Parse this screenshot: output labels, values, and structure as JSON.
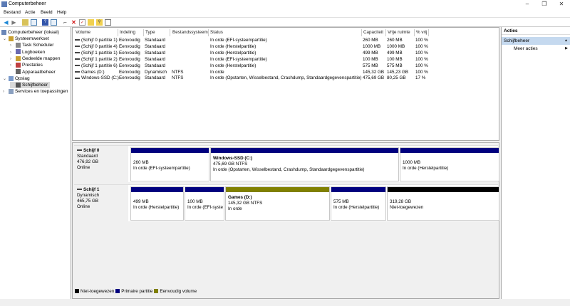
{
  "window": {
    "title": "Computerbeheer",
    "minimize": "–",
    "maximize": "❐",
    "close": "✕"
  },
  "menu": [
    "Bestand",
    "Actie",
    "Beeld",
    "Help"
  ],
  "toolbar_icons": [
    "back-icon",
    "forward-icon",
    "up-folder-icon",
    "show-hide-tree-icon",
    "help-icon",
    "properties-icon",
    "connect-icon",
    "delete-icon",
    "check-icon",
    "new-folder-icon",
    "search-icon",
    "view-icon"
  ],
  "tree": {
    "root": "Computerbeheer (lokaal)",
    "items": [
      {
        "label": "Systeemwerkset",
        "level": 1,
        "expand": "⌄"
      },
      {
        "label": "Task Scheduler",
        "level": 2,
        "expand": "›"
      },
      {
        "label": "Logboeken",
        "level": 2,
        "expand": "›"
      },
      {
        "label": "Gedeelde mappen",
        "level": 2,
        "expand": "›"
      },
      {
        "label": "Prestaties",
        "level": 2,
        "expand": "›"
      },
      {
        "label": "Apparaatbeheer",
        "level": 2,
        "expand": ""
      },
      {
        "label": "Opslag",
        "level": 1,
        "expand": "⌄"
      },
      {
        "label": "Schijfbeheer",
        "level": 2,
        "expand": "",
        "selected": true
      },
      {
        "label": "Services en toepassingen",
        "level": 1,
        "expand": "›"
      }
    ]
  },
  "volumes": {
    "columns": [
      "Volume",
      "Indeling",
      "Type",
      "Bestandssysteem",
      "Status",
      "Capaciteit",
      "Vrije ruimte",
      "% vrij"
    ],
    "rows": [
      [
        "(Schijf 0 partitie 1)",
        "Eenvoudig",
        "Standaard",
        "",
        "In orde (EFI-systeempartitie)",
        "260 MB",
        "260 MB",
        "100 %"
      ],
      [
        "(Schijf 0 partitie 4)",
        "Eenvoudig",
        "Standaard",
        "",
        "In orde (Herstelpartitie)",
        "1000 MB",
        "1000 MB",
        "100 %"
      ],
      [
        "(Schijf 1 partitie 1)",
        "Eenvoudig",
        "Standaard",
        "",
        "In orde (Herstelpartitie)",
        "499 MB",
        "499 MB",
        "100 %"
      ],
      [
        "(Schijf 1 partitie 2)",
        "Eenvoudig",
        "Standaard",
        "",
        "In orde (EFI-systeempartitie)",
        "100 MB",
        "100 MB",
        "100 %"
      ],
      [
        "(Schijf 1 partitie 6)",
        "Eenvoudig",
        "Standaard",
        "",
        "In orde (Herstelpartitie)",
        "575 MB",
        "575 MB",
        "100 %"
      ],
      [
        "Games (D:)",
        "Eenvoudig",
        "Dynamisch",
        "NTFS",
        "In orde",
        "145,32 GB",
        "145,23 GB",
        "100 %"
      ],
      [
        "Windows-SSD (C:)",
        "Eenvoudig",
        "Standaard",
        "NTFS",
        "In orde (Opstarten, Wisselbestand, Crashdump, Standaardgegevenspartitie)",
        "475,69 GB",
        "80,25 GB",
        "17 %"
      ]
    ]
  },
  "disks": [
    {
      "name": "Schijf 0",
      "type": "Standaard",
      "size": "476,92 GB",
      "state": "Online",
      "partitions": [
        {
          "title": "",
          "size": "260 MB",
          "status": "In orde (EFI-systeempartitie)",
          "kind": "primary"
        },
        {
          "title": "Windows-SSD  (C:)",
          "size": "475,69 GB NTFS",
          "status": "In orde (Opstarten, Wisselbestand, Crashdump, Standaardgegevenspartitie)",
          "kind": "primary"
        },
        {
          "title": "",
          "size": "1000 MB",
          "status": "In orde (Herstelpartitie)",
          "kind": "primary"
        }
      ]
    },
    {
      "name": "Schijf 1",
      "type": "Dynamisch",
      "size": "465,75 GB",
      "state": "Online",
      "partitions": [
        {
          "title": "",
          "size": "499 MB",
          "status": "In orde (Herstelpartitie)",
          "kind": "primary"
        },
        {
          "title": "",
          "size": "100 MB",
          "status": "In orde (EFI-syste",
          "kind": "primary"
        },
        {
          "title": "Games  (D:)",
          "size": "145,32 GB NTFS",
          "status": "In orde",
          "kind": "simple"
        },
        {
          "title": "",
          "size": "575 MB",
          "status": "In orde (Herstelpartitie)",
          "kind": "primary"
        },
        {
          "title": "",
          "size": "319,28 GB",
          "status": "Niet-toegewezen",
          "kind": "unallocated"
        }
      ]
    }
  ],
  "legend": [
    {
      "label": "Niet-toegewezen",
      "color": "#000000"
    },
    {
      "label": "Primaire partitie",
      "color": "#00007f"
    },
    {
      "label": "Eenvoudig volume",
      "color": "#808000"
    }
  ],
  "actions": {
    "header": "Acties",
    "section": "Schijfbeheer",
    "section_arrow": "▲",
    "items": [
      {
        "label": "Meer acties",
        "arrow": "▶"
      }
    ]
  },
  "colors": {
    "primary": "#00007f",
    "simple": "#808000",
    "unallocated": "#000000",
    "selected_action": "#c5d9ef"
  }
}
